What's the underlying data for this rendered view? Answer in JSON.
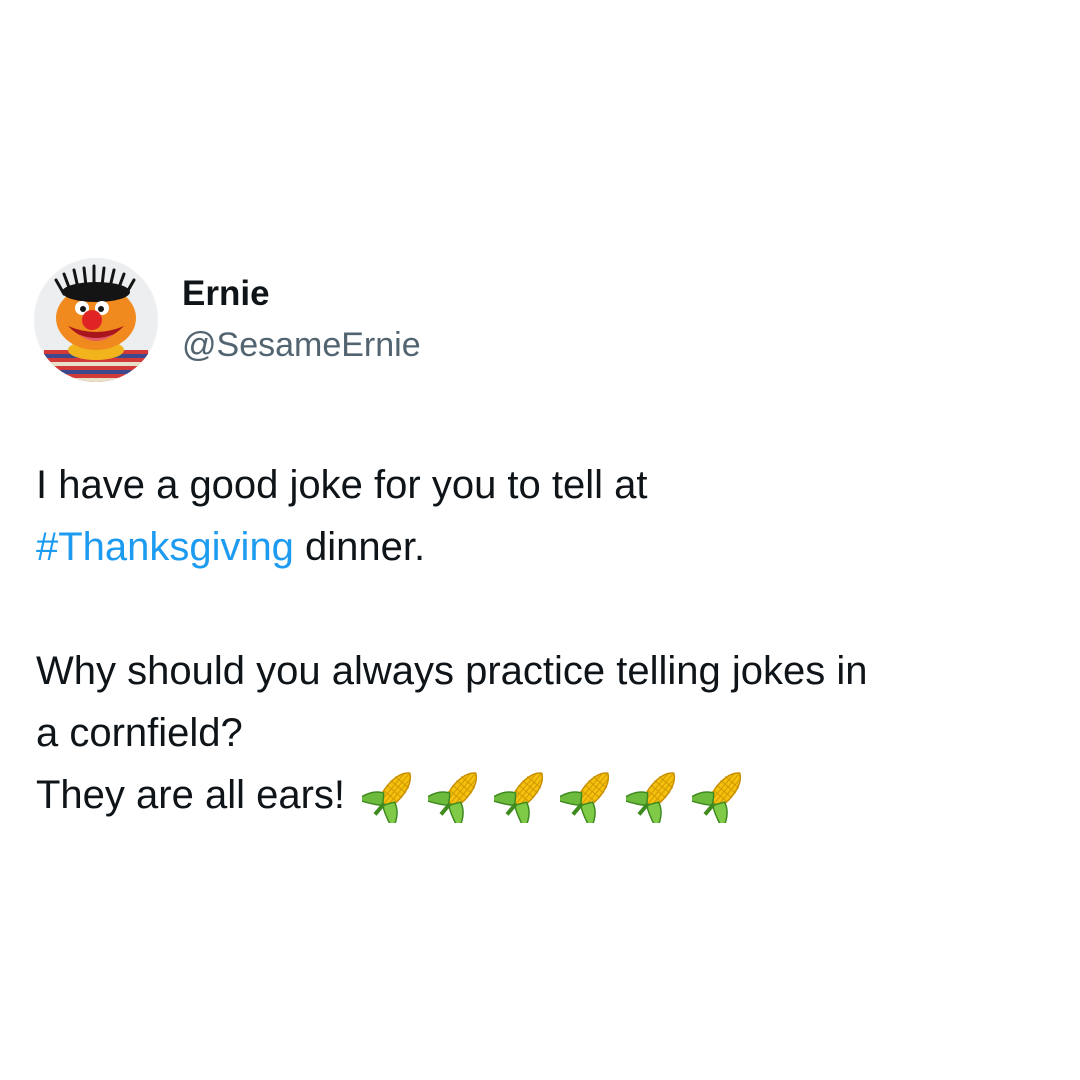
{
  "author": {
    "display_name": "Ernie",
    "handle": "@SesameErnie",
    "avatar_icon": "ernie-avatar"
  },
  "tweet": {
    "line1": "I have a good joke for you to tell at",
    "hashtag": "#Thanksgiving",
    "line2_rest": " dinner.",
    "line3": "Why should you always practice telling jokes in",
    "line4": "a cornfield?",
    "line5": "They are all ears! ",
    "emoji_icon": "corn-icon",
    "emoji_count": 6
  },
  "colors": {
    "hashtag": "#1d9bf0",
    "text": "#0f1419",
    "handle": "#536471",
    "background": "#ffffff"
  }
}
